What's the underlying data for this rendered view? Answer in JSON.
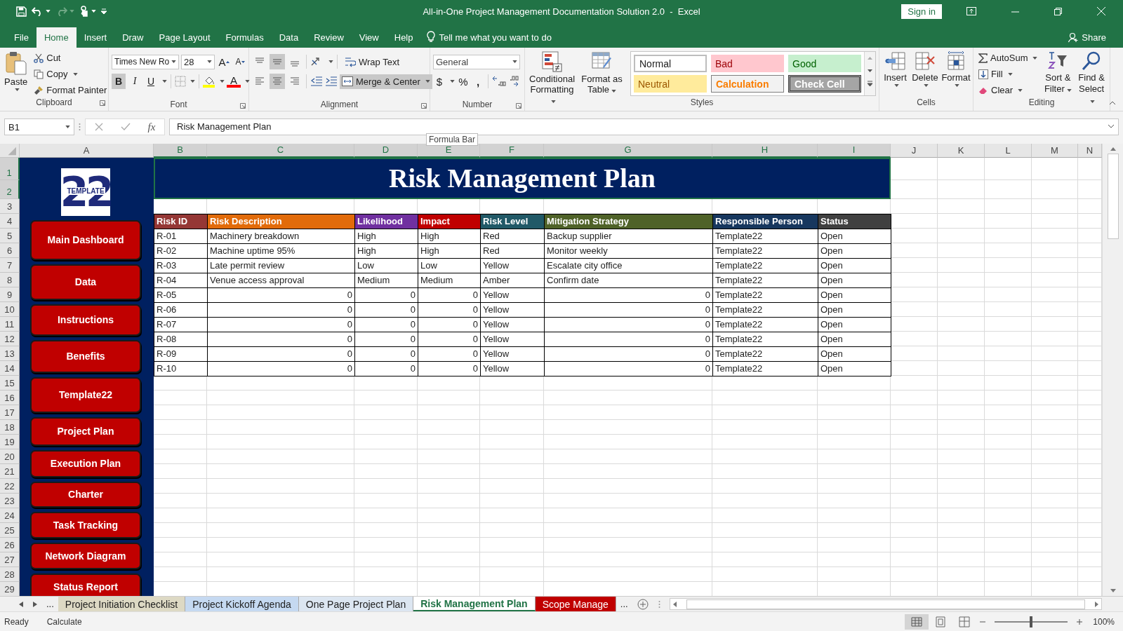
{
  "window": {
    "title": "All-in-One Project Management Documentation Solution 2.0  -  Excel",
    "sign_in": "Sign in",
    "share": "Share"
  },
  "ribbon_tabs": [
    {
      "label": "File",
      "selected": false
    },
    {
      "label": "Home",
      "selected": true
    },
    {
      "label": "Insert",
      "selected": false
    },
    {
      "label": "Draw",
      "selected": false
    },
    {
      "label": "Page Layout",
      "selected": false
    },
    {
      "label": "Formulas",
      "selected": false
    },
    {
      "label": "Data",
      "selected": false
    },
    {
      "label": "Review",
      "selected": false
    },
    {
      "label": "View",
      "selected": false
    },
    {
      "label": "Help",
      "selected": false
    }
  ],
  "tell_me": "Tell me what you want to do",
  "clipboard": {
    "paste": "Paste",
    "cut": "Cut",
    "copy": "Copy",
    "format_painter": "Format Painter",
    "label": "Clipboard"
  },
  "font": {
    "name": "Times New Ro",
    "size": "28",
    "grow": "A",
    "shrink": "A",
    "bold": {
      "text": "B",
      "selected": true
    },
    "italic": {
      "text": "I",
      "selected": false
    },
    "underline": {
      "text": "U",
      "selected": false
    },
    "font_color": "A",
    "label": "Font"
  },
  "alignment": {
    "vertical": [
      {
        "kind": "top",
        "selected": false
      },
      {
        "kind": "middle",
        "selected": true
      },
      {
        "kind": "bottom",
        "selected": false
      }
    ],
    "horizontal": [
      {
        "kind": "left",
        "selected": false
      },
      {
        "kind": "center",
        "selected": true
      },
      {
        "kind": "right",
        "selected": false
      }
    ],
    "wrap_text": "Wrap Text",
    "merge_center": {
      "label": "Merge & Center",
      "selected": true
    },
    "label": "Alignment"
  },
  "number": {
    "format": "General",
    "currency": "$",
    "percent": "%",
    "comma": ",",
    "label": "Number"
  },
  "styles": {
    "conditional_formatting": "Conditional Formatting",
    "format_as_table": "Format as Table",
    "gallery": [
      {
        "label": "Normal",
        "kind": "normal"
      },
      {
        "label": "Bad",
        "kind": "bad"
      },
      {
        "label": "Good",
        "kind": "good"
      },
      {
        "label": "Neutral",
        "kind": "neutral"
      },
      {
        "label": "Calculation",
        "kind": "calculation"
      },
      {
        "label": "Check Cell",
        "kind": "check"
      }
    ],
    "label": "Styles"
  },
  "cells": {
    "insert": "Insert",
    "delete": "Delete",
    "format": "Format",
    "label": "Cells"
  },
  "editing": {
    "autosum": "AutoSum",
    "fill": "Fill",
    "clear": "Clear",
    "sort_filter": "Sort & Filter",
    "find_select": "Find & Select",
    "label": "Editing"
  },
  "formula_bar": {
    "name_box": "B1",
    "fx": "fx",
    "formula": "Risk Management Plan",
    "tooltip": "Formula Bar"
  },
  "columns": [
    {
      "label": "A",
      "selected": false
    },
    {
      "label": "B",
      "selected": true
    },
    {
      "label": "C",
      "selected": true
    },
    {
      "label": "D",
      "selected": true
    },
    {
      "label": "E",
      "selected": true
    },
    {
      "label": "F",
      "selected": true
    },
    {
      "label": "G",
      "selected": true
    },
    {
      "label": "H",
      "selected": true
    },
    {
      "label": "I",
      "selected": true
    },
    {
      "label": "J",
      "selected": false
    },
    {
      "label": "K",
      "selected": false
    },
    {
      "label": "L",
      "selected": false
    },
    {
      "label": "M",
      "selected": false
    },
    {
      "label": "N",
      "selected": false
    }
  ],
  "row_numbers": [
    {
      "label": "1",
      "selected": true
    },
    {
      "label": "2",
      "selected": true
    },
    {
      "label": "3",
      "selected": false
    },
    {
      "label": "4",
      "selected": false
    },
    {
      "label": "5",
      "selected": false
    },
    {
      "label": "6",
      "selected": false
    },
    {
      "label": "7",
      "selected": false
    },
    {
      "label": "8",
      "selected": false
    },
    {
      "label": "9",
      "selected": false
    },
    {
      "label": "10",
      "selected": false
    },
    {
      "label": "11",
      "selected": false
    },
    {
      "label": "12",
      "selected": false
    },
    {
      "label": "13",
      "selected": false
    },
    {
      "label": "14",
      "selected": false
    },
    {
      "label": "15",
      "selected": false
    },
    {
      "label": "16",
      "selected": false
    },
    {
      "label": "17",
      "selected": false
    },
    {
      "label": "18",
      "selected": false
    },
    {
      "label": "19",
      "selected": false
    },
    {
      "label": "20",
      "selected": false
    },
    {
      "label": "21",
      "selected": false
    },
    {
      "label": "22",
      "selected": false
    },
    {
      "label": "23",
      "selected": false
    },
    {
      "label": "24",
      "selected": false
    },
    {
      "label": "25",
      "selected": false
    },
    {
      "label": "26",
      "selected": false
    },
    {
      "label": "27",
      "selected": false
    },
    {
      "label": "28",
      "selected": false
    },
    {
      "label": "29",
      "selected": false
    }
  ],
  "sidebar": {
    "logo": {
      "number": "22",
      "word": "TEMPLATE"
    },
    "buttons": [
      "Main Dashboard",
      "Data",
      "Instructions",
      "Benefits",
      "Template22",
      "Project Plan",
      "Execution Plan",
      "Charter",
      "Task Tracking",
      "Network Diagram",
      "Status Report"
    ]
  },
  "sheet": {
    "title": "Risk Management Plan",
    "headers": [
      {
        "label": "Risk ID",
        "color": "#953735"
      },
      {
        "label": "Risk Description",
        "color": "#e26b0a"
      },
      {
        "label": "Likelihood",
        "color": "#7030a0"
      },
      {
        "label": "Impact",
        "color": "#c00000"
      },
      {
        "label": "Risk Level",
        "color": "#215967"
      },
      {
        "label": "Mitigation Strategy",
        "color": "#4f6228"
      },
      {
        "label": "Responsible Person",
        "color": "#17375e"
      },
      {
        "label": "Status",
        "color": "#404040"
      }
    ],
    "rows": [
      [
        {
          "text": "R-01",
          "kind": "text"
        },
        {
          "text": "Machinery breakdown",
          "kind": "text"
        },
        {
          "text": "High",
          "kind": "text"
        },
        {
          "text": "High",
          "kind": "text"
        },
        {
          "text": "Red",
          "kind": "text"
        },
        {
          "text": "Backup supplier",
          "kind": "text"
        },
        {
          "text": "Template22",
          "kind": "text"
        },
        {
          "text": "Open",
          "kind": "text"
        }
      ],
      [
        {
          "text": "R-02",
          "kind": "text"
        },
        {
          "text": "Machine uptime 95%",
          "kind": "text"
        },
        {
          "text": "High",
          "kind": "text"
        },
        {
          "text": "High",
          "kind": "text"
        },
        {
          "text": "Red",
          "kind": "text"
        },
        {
          "text": "Monitor weekly",
          "kind": "text"
        },
        {
          "text": "Template22",
          "kind": "text"
        },
        {
          "text": "Open",
          "kind": "text"
        }
      ],
      [
        {
          "text": "R-03",
          "kind": "text"
        },
        {
          "text": "Late permit review",
          "kind": "text"
        },
        {
          "text": "Low",
          "kind": "text"
        },
        {
          "text": "Low",
          "kind": "text"
        },
        {
          "text": "Yellow",
          "kind": "text"
        },
        {
          "text": "Escalate city office",
          "kind": "text"
        },
        {
          "text": "Template22",
          "kind": "text"
        },
        {
          "text": "Open",
          "kind": "text"
        }
      ],
      [
        {
          "text": "R-04",
          "kind": "text"
        },
        {
          "text": "Venue access approval",
          "kind": "text"
        },
        {
          "text": "Medium",
          "kind": "text"
        },
        {
          "text": "Medium",
          "kind": "text"
        },
        {
          "text": "Amber",
          "kind": "text"
        },
        {
          "text": "Confirm date",
          "kind": "text"
        },
        {
          "text": "Template22",
          "kind": "text"
        },
        {
          "text": "Open",
          "kind": "text"
        }
      ],
      [
        {
          "text": "R-05",
          "kind": "text"
        },
        {
          "text": "0",
          "kind": "number"
        },
        {
          "text": "0",
          "kind": "number"
        },
        {
          "text": "0",
          "kind": "number"
        },
        {
          "text": "Yellow",
          "kind": "text"
        },
        {
          "text": "0",
          "kind": "number"
        },
        {
          "text": "Template22",
          "kind": "text"
        },
        {
          "text": "Open",
          "kind": "text"
        }
      ],
      [
        {
          "text": "R-06",
          "kind": "text"
        },
        {
          "text": "0",
          "kind": "number"
        },
        {
          "text": "0",
          "kind": "number"
        },
        {
          "text": "0",
          "kind": "number"
        },
        {
          "text": "Yellow",
          "kind": "text"
        },
        {
          "text": "0",
          "kind": "number"
        },
        {
          "text": "Template22",
          "kind": "text"
        },
        {
          "text": "Open",
          "kind": "text"
        }
      ],
      [
        {
          "text": "R-07",
          "kind": "text"
        },
        {
          "text": "0",
          "kind": "number"
        },
        {
          "text": "0",
          "kind": "number"
        },
        {
          "text": "0",
          "kind": "number"
        },
        {
          "text": "Yellow",
          "kind": "text"
        },
        {
          "text": "0",
          "kind": "number"
        },
        {
          "text": "Template22",
          "kind": "text"
        },
        {
          "text": "Open",
          "kind": "text"
        }
      ],
      [
        {
          "text": "R-08",
          "kind": "text"
        },
        {
          "text": "0",
          "kind": "number"
        },
        {
          "text": "0",
          "kind": "number"
        },
        {
          "text": "0",
          "kind": "number"
        },
        {
          "text": "Yellow",
          "kind": "text"
        },
        {
          "text": "0",
          "kind": "number"
        },
        {
          "text": "Template22",
          "kind": "text"
        },
        {
          "text": "Open",
          "kind": "text"
        }
      ],
      [
        {
          "text": "R-09",
          "kind": "text"
        },
        {
          "text": "0",
          "kind": "number"
        },
        {
          "text": "0",
          "kind": "number"
        },
        {
          "text": "0",
          "kind": "number"
        },
        {
          "text": "Yellow",
          "kind": "text"
        },
        {
          "text": "0",
          "kind": "number"
        },
        {
          "text": "Template22",
          "kind": "text"
        },
        {
          "text": "Open",
          "kind": "text"
        }
      ],
      [
        {
          "text": "R-10",
          "kind": "text"
        },
        {
          "text": "0",
          "kind": "number"
        },
        {
          "text": "0",
          "kind": "number"
        },
        {
          "text": "0",
          "kind": "number"
        },
        {
          "text": "Yellow",
          "kind": "text"
        },
        {
          "text": "0",
          "kind": "number"
        },
        {
          "text": "Template22",
          "kind": "text"
        },
        {
          "text": "Open",
          "kind": "text"
        }
      ]
    ]
  },
  "sheet_tabs": {
    "more_before": "...",
    "tabs": [
      {
        "label": "Project Initiation Checklist",
        "color": "#ddd9c4",
        "selected": false
      },
      {
        "label": "Project Kickoff Agenda",
        "color": "#c5d9f1",
        "selected": false
      },
      {
        "label": "One Page Project Plan",
        "color": "#dce6f1",
        "selected": false
      },
      {
        "label": "Risk Management Plan",
        "color": "#ffffff",
        "selected": true
      },
      {
        "label": "Scope Manage",
        "color": "#c00000",
        "selected": false
      }
    ],
    "more_after": "..."
  },
  "status_bar": {
    "ready": "Ready",
    "calculate": "Calculate",
    "zoom": "100%",
    "zoom_slider": {
      "level": 0.5
    }
  }
}
